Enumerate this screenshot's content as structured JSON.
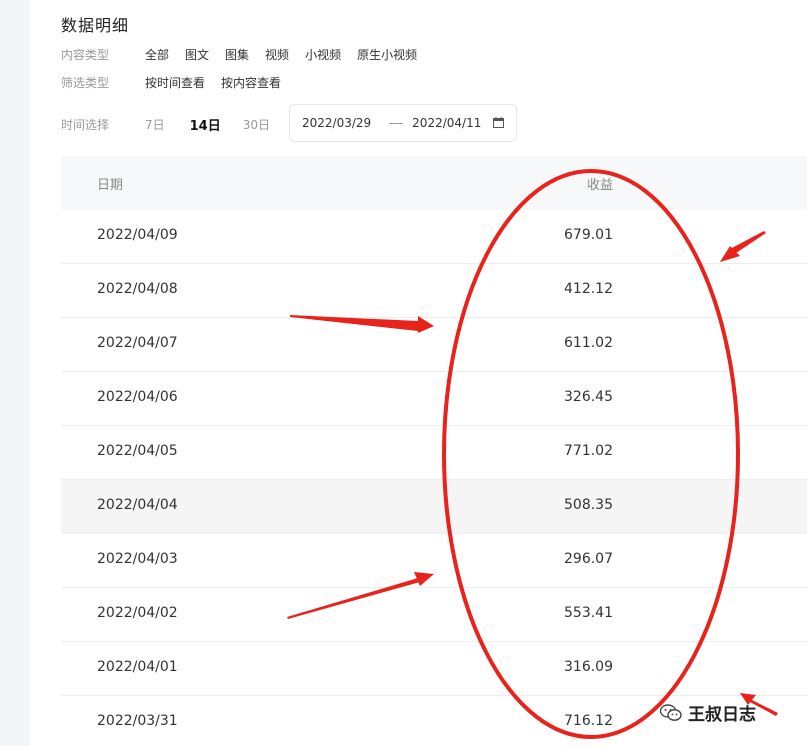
{
  "page": {
    "title": "数据明细"
  },
  "filters": {
    "content_type": {
      "label": "内容类型",
      "options": [
        "全部",
        "图文",
        "图集",
        "视频",
        "小视频",
        "原生小视频"
      ]
    },
    "screen_type": {
      "label": "筛选类型",
      "options": [
        "按时间查看",
        "按内容查看"
      ]
    },
    "time": {
      "label": "时间选择",
      "options": [
        "7日",
        "14日",
        "30日"
      ],
      "selected": "14日",
      "start_date": "2022/03/29",
      "end_date": "2022/04/11"
    }
  },
  "table": {
    "headers": [
      "日期",
      "收益"
    ],
    "rows": [
      {
        "date": "2022/04/09",
        "income": "679.01"
      },
      {
        "date": "2022/04/08",
        "income": "412.12"
      },
      {
        "date": "2022/04/07",
        "income": "611.02"
      },
      {
        "date": "2022/04/06",
        "income": "326.45"
      },
      {
        "date": "2022/04/05",
        "income": "771.02"
      },
      {
        "date": "2022/04/04",
        "income": "508.35"
      },
      {
        "date": "2022/04/03",
        "income": "296.07"
      },
      {
        "date": "2022/04/02",
        "income": "553.41"
      },
      {
        "date": "2022/04/01",
        "income": "316.09"
      },
      {
        "date": "2022/03/31",
        "income": "716.12"
      }
    ]
  },
  "annotation": {
    "color": "#e8231b"
  },
  "watermark": {
    "text": "王叔日志",
    "icon": "wechat-icon"
  },
  "icons": {
    "calendar": "calendar-icon"
  }
}
